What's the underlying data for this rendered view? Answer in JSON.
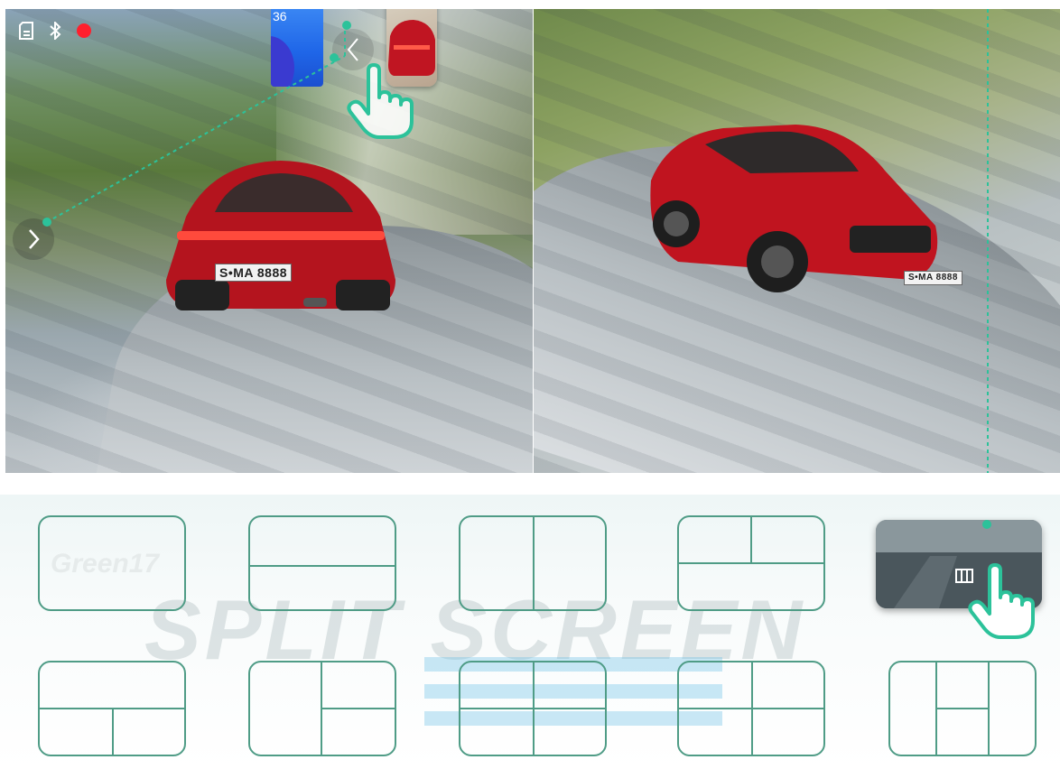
{
  "status_bar": {
    "icons": [
      "sd-card-icon",
      "bluetooth-icon",
      "record-dot-icon"
    ],
    "record_color": "#ff1f2d"
  },
  "split_view": {
    "left_pane": {
      "plate_text": "S•MA 8888"
    },
    "right_pane": {
      "plate_text": "S•MA 8888"
    },
    "thumbnail_label": "36"
  },
  "layout_panel": {
    "faint_label": "Green17",
    "watermark": "SPLIT SCREEN",
    "selected_layout": "layout-preview-active",
    "accent_color": "#4f9c86",
    "guide_color": "#2cc29a"
  }
}
